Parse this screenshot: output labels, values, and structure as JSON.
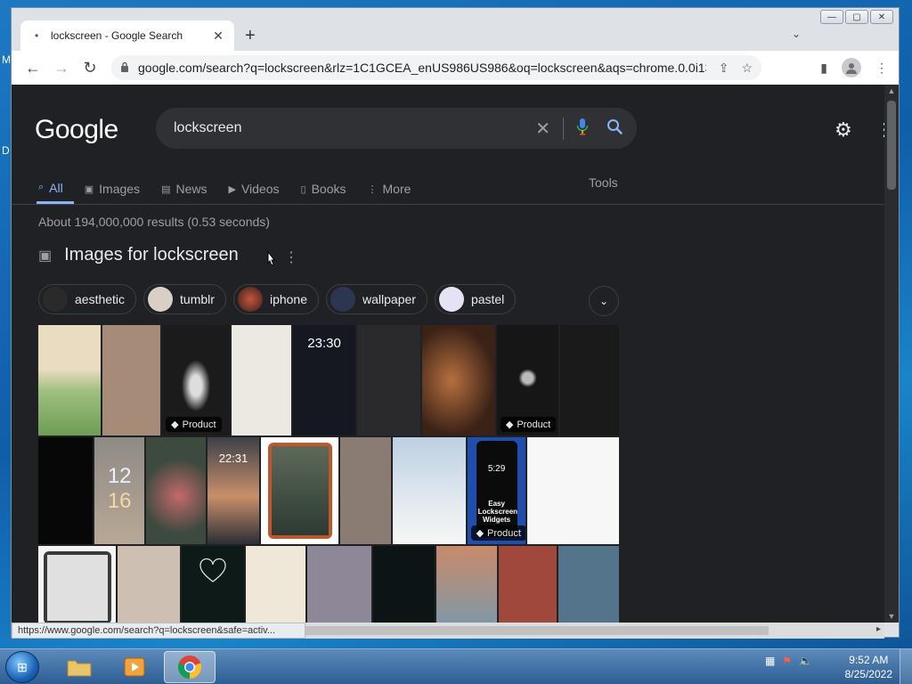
{
  "desktop": {
    "glyph_m": "M",
    "glyph_d": "D"
  },
  "window": {
    "minimize": "—",
    "maximize": "▢",
    "close": "✕"
  },
  "tab": {
    "favicon": "•",
    "title": "lockscreen - Google Search",
    "close": "✕",
    "new_tab": "+",
    "dropdown": "⌄"
  },
  "toolbar": {
    "back": "←",
    "forward": "→",
    "reload": "↻",
    "url": "google.com/search?q=lockscreen&rlz=1C1GCEA_enUS986US986&oq=lockscreen&aqs=chrome.0.0i131i433i...",
    "share_icon": "⇪",
    "star_icon": "☆",
    "sidepanel_icon": "▮",
    "menu_icon": "⋮"
  },
  "page": {
    "logo": "Google",
    "query": "lockscreen",
    "clear": "✕",
    "mic": "🎙",
    "search": "⌕",
    "settings": "⚙",
    "apps": "⋮",
    "tabs": [
      {
        "label": "All",
        "icon": "⌕"
      },
      {
        "label": "Images",
        "icon": "▣"
      },
      {
        "label": "News",
        "icon": "▤"
      },
      {
        "label": "Videos",
        "icon": "▶"
      },
      {
        "label": "Books",
        "icon": "▯"
      },
      {
        "label": "More",
        "icon": "⋮"
      }
    ],
    "tools": "Tools",
    "result_stats": "About 194,000,000 results (0.53 seconds)",
    "images_heading": "Images for lockscreen",
    "images_heading_icon": "▣",
    "images_kebab": "⋮",
    "chips": [
      {
        "label": "aesthetic",
        "color": "#2a2a2a"
      },
      {
        "label": "tumblr",
        "color": "#d8cfc7"
      },
      {
        "label": "iphone",
        "color": "#7a3a2c"
      },
      {
        "label": "wallpaper",
        "color": "#2c3650"
      },
      {
        "label": "pastel",
        "color": "#e4e2f4"
      }
    ],
    "chip_expand": "⌄",
    "product_label": "Product",
    "product_icon": "◆",
    "tile_time_1": "23:30",
    "tile_time_2": "22:31",
    "tile_num_1": "12",
    "tile_num_2": "16",
    "tile_clock_3": "5:29",
    "tile_widgets_text": "Easy Lockscreen Widgets"
  },
  "statusbar": {
    "url": "https://www.google.com/search?q=lockscreen&safe=activ...",
    "arrow": "▸"
  },
  "taskbar": {
    "start": "⊞",
    "explorer_icon": "🗀",
    "media_icon": "▶",
    "chrome_icon": "◉",
    "time": "9:52 AM",
    "date": "8/25/2022",
    "tray_network": "▦",
    "tray_flag": "⚑",
    "tray_volume": "🔈"
  }
}
